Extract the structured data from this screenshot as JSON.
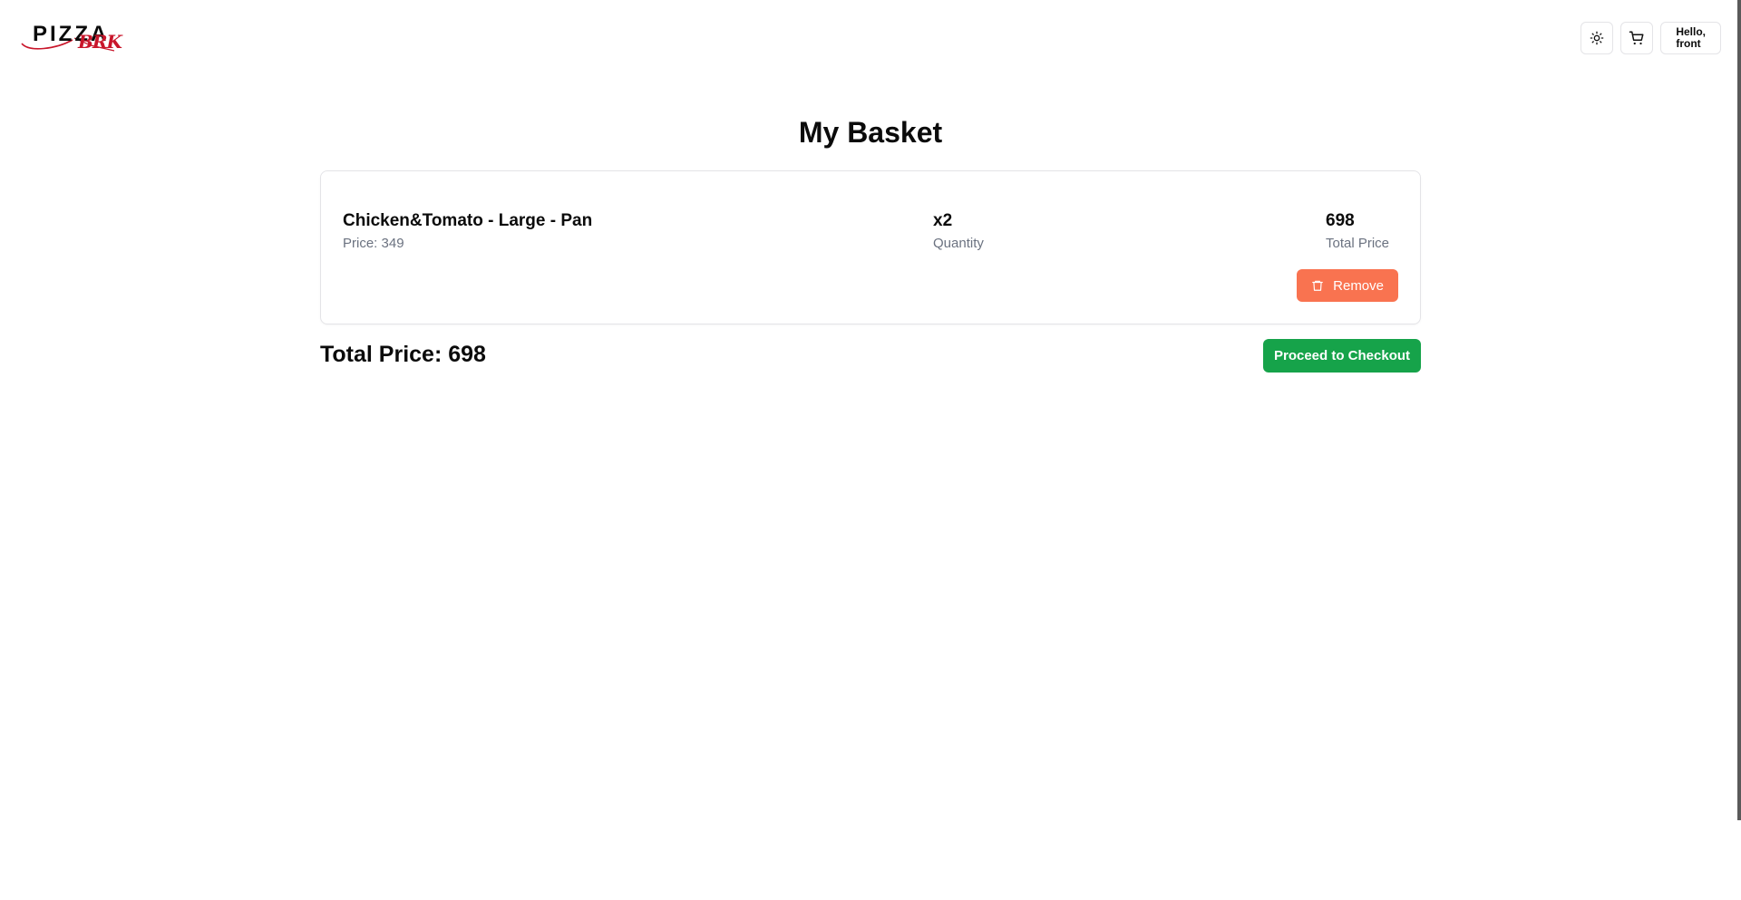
{
  "brand": {
    "logo_main": "PIZZA",
    "logo_sub": "BRK",
    "logo_color": "#c9162b"
  },
  "header": {
    "theme_icon": "sun-icon",
    "cart_icon": "cart-icon",
    "greeting_line1": "Hello,",
    "greeting_line2": "front"
  },
  "page": {
    "title": "My Basket"
  },
  "basket": {
    "items": [
      {
        "name": "Chicken&Tomato - Large - Pan",
        "price_text": "Price: 349",
        "quantity": "x2",
        "quantity_label": "Quantity",
        "total": "698",
        "total_label": "Total Price",
        "remove_label": "Remove",
        "remove_icon": "trash-icon"
      }
    ],
    "grand_total_text": "Total Price: 698",
    "checkout_label": "Proceed to Checkout"
  },
  "colors": {
    "remove_button": "#f97350",
    "checkout_button": "#16a34a",
    "muted_text": "#6b7280",
    "border": "#e4e4e7"
  }
}
